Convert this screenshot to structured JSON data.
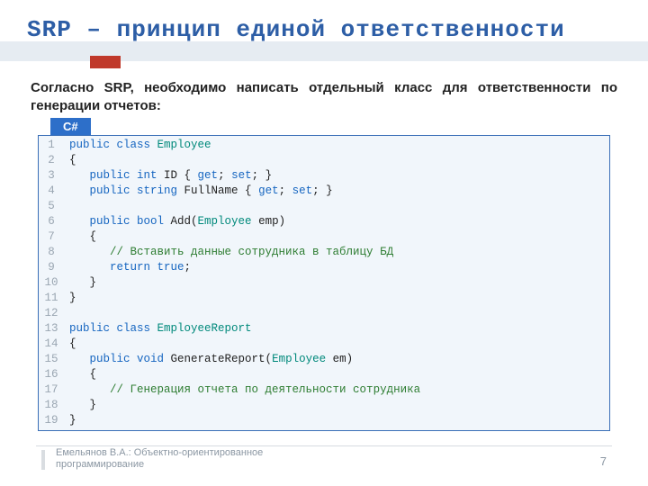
{
  "title": "SRP – принцип единой ответственности",
  "subtitle": "Согласно SRP, необходимо написать отдельный класс для ответственности по генерации отчетов:",
  "badge": "C#",
  "code": {
    "lines": [
      [
        [
          "kw",
          "public class "
        ],
        [
          "type",
          "Employee"
        ]
      ],
      [
        [
          "",
          "{"
        ]
      ],
      [
        [
          "",
          "   "
        ],
        [
          "kw",
          "public int"
        ],
        [
          "",
          " ID { "
        ],
        [
          "kw",
          "get"
        ],
        [
          "",
          "; "
        ],
        [
          "kw",
          "set"
        ],
        [
          "",
          "; }"
        ]
      ],
      [
        [
          "",
          "   "
        ],
        [
          "kw",
          "public string"
        ],
        [
          "",
          " FullName { "
        ],
        [
          "kw",
          "get"
        ],
        [
          "",
          "; "
        ],
        [
          "kw",
          "set"
        ],
        [
          "",
          "; }"
        ]
      ],
      [
        [
          "",
          ""
        ]
      ],
      [
        [
          "",
          "   "
        ],
        [
          "kw",
          "public bool"
        ],
        [
          "",
          " Add("
        ],
        [
          "type",
          "Employee"
        ],
        [
          "",
          " emp)"
        ]
      ],
      [
        [
          "",
          "   {"
        ]
      ],
      [
        [
          "",
          "      "
        ],
        [
          "cmt",
          "// Вставить данные сотрудника в таблицу БД"
        ]
      ],
      [
        [
          "",
          "      "
        ],
        [
          "kw",
          "return true"
        ],
        [
          "",
          ";"
        ]
      ],
      [
        [
          "",
          "   }"
        ]
      ],
      [
        [
          "",
          "}"
        ]
      ],
      [
        [
          "",
          ""
        ]
      ],
      [
        [
          "kw",
          "public class "
        ],
        [
          "type",
          "EmployeeReport"
        ]
      ],
      [
        [
          "",
          "{"
        ]
      ],
      [
        [
          "",
          "   "
        ],
        [
          "kw",
          "public void"
        ],
        [
          "",
          " GenerateReport("
        ],
        [
          "type",
          "Employee"
        ],
        [
          "",
          " em)"
        ]
      ],
      [
        [
          "",
          "   {"
        ]
      ],
      [
        [
          "",
          "      "
        ],
        [
          "cmt",
          "// Генерация отчета по деятельности сотрудника"
        ]
      ],
      [
        [
          "",
          "   }"
        ]
      ],
      [
        [
          "",
          "}"
        ]
      ]
    ]
  },
  "footer": "Емельянов В.А.: Объектно-ориентированное программирование",
  "page": "7"
}
